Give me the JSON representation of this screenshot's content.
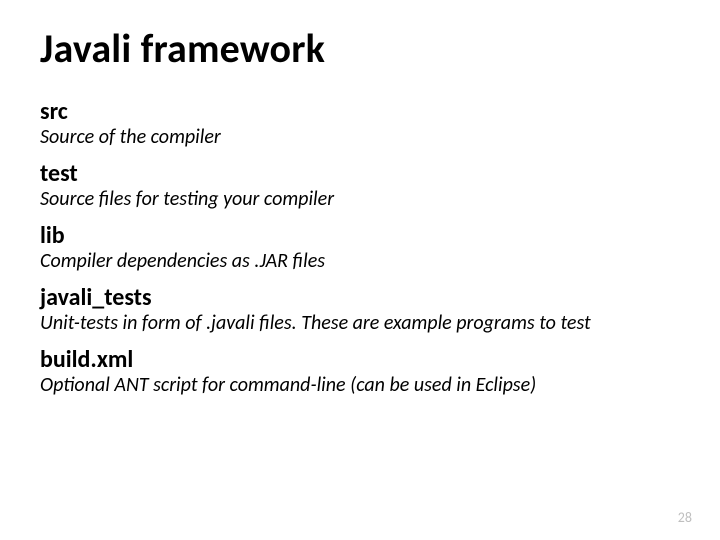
{
  "title": "Javali framework",
  "entries": [
    {
      "name": "src",
      "desc": "Source of the compiler"
    },
    {
      "name": "test",
      "desc": "Source files for testing your compiler"
    },
    {
      "name": "lib",
      "desc": "Compiler dependencies as .JAR files"
    },
    {
      "name": "javali_tests",
      "desc": "Unit-tests in form of .javali files. These are example programs to test"
    },
    {
      "name": "build.xml",
      "desc": "Optional ANT script for command-line (can be used in Eclipse)"
    }
  ],
  "page_number": "28"
}
